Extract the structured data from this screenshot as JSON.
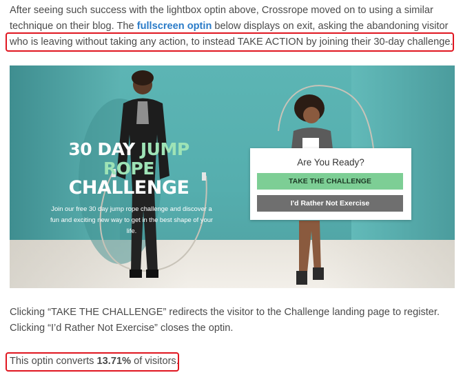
{
  "intro": {
    "before_link": "After seeing such success with the lightbox optin above, Crossrope moved on to using a similar technique on their blog. The ",
    "link_text": "fullscreen optin",
    "after_link": " below displays on exit, asking the abandoning visitor",
    "highlighted_line": "who is leaving without taking any action, to instead TAKE ACTION by joining their 30-day challenge."
  },
  "hero": {
    "heading_part1": "30 DAY ",
    "heading_part1_accent": "JUMP",
    "heading_line2": "ROPE",
    "heading_line3": "CHALLENGE",
    "subtext": "Join our free 30 day jump rope challenge and discover a fun and exciting new way to get in the best shape of your life.",
    "optin": {
      "title": "Are You Ready?",
      "accept_label": "TAKE THE CHALLENGE",
      "decline_label": "I'd Rather Not Exercise"
    }
  },
  "body": {
    "paragraph_2": "Clicking “TAKE THE CHALLENGE” redirects the visitor to the Challenge landing page to register. Clicking “I’d Rather Not Exercise” closes the optin.",
    "stat_before": "This optin converts ",
    "stat_value": "13.71%",
    "stat_after": " of visitors."
  },
  "colors": {
    "link": "#2a7bc8",
    "highlight_border": "#e0151f",
    "accept_button": "#7dce95",
    "decline_button": "#6f6f6f",
    "hero_background": "#5cb5b4",
    "heading_accent": "#9ee3b6"
  }
}
